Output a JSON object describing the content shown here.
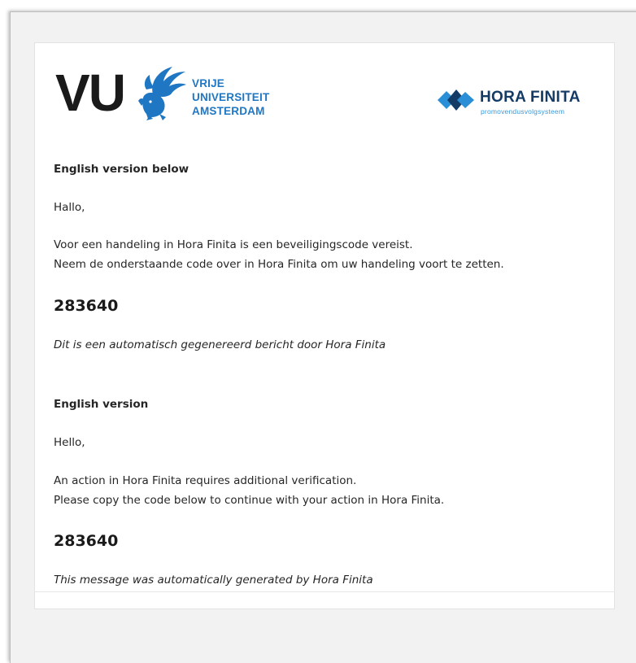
{
  "logos": {
    "vu": {
      "letters": "VU",
      "name_lines": [
        "VRIJE",
        "UNIVERSITEIT",
        "AMSTERDAM"
      ],
      "icon": "griffin-icon",
      "color": "#1f77c4"
    },
    "hora_finita": {
      "title": "HORA FINITA",
      "subtitle": "promovendusvolgsysteem",
      "icon": "hora-finita-diamond-icon",
      "color": "#143b66",
      "accent": "#2a8fd6"
    }
  },
  "dutch": {
    "heading": "English version below",
    "greeting": "Hallo,",
    "line1": "Voor een handeling in Hora Finita is een beveiligingscode vereist.",
    "line2": "Neem de onderstaande code over in Hora Finita om uw handeling voort te zetten.",
    "code": "283640",
    "footer": "Dit is een automatisch gegenereerd bericht door Hora Finita"
  },
  "english": {
    "heading": "English version",
    "greeting": "Hello,",
    "line1": "An action in Hora Finita requires additional verification.",
    "line2": "Please copy the code below to continue with your action in Hora Finita.",
    "code": "283640",
    "footer": "This message was automatically generated by Hora Finita"
  }
}
